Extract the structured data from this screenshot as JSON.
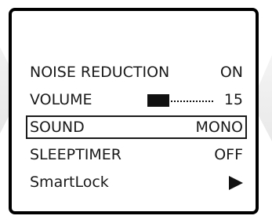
{
  "menu": {
    "noise_reduction": {
      "label": "NOISE REDUCTION",
      "value": "ON"
    },
    "volume": {
      "label": "VOLUME",
      "value": "15",
      "level_fraction": 0.33
    },
    "sound": {
      "label": "SOUND",
      "value": "MONO",
      "selected": true
    },
    "sleeptimer": {
      "label": "SLEEPTIMER",
      "value": "OFF"
    },
    "smartlock": {
      "label": "SmartLock",
      "value_icon": "play-arrow-icon"
    }
  },
  "colors": {
    "text": "#1a1a1a",
    "frame": "#000000",
    "background": "#ffffff"
  }
}
